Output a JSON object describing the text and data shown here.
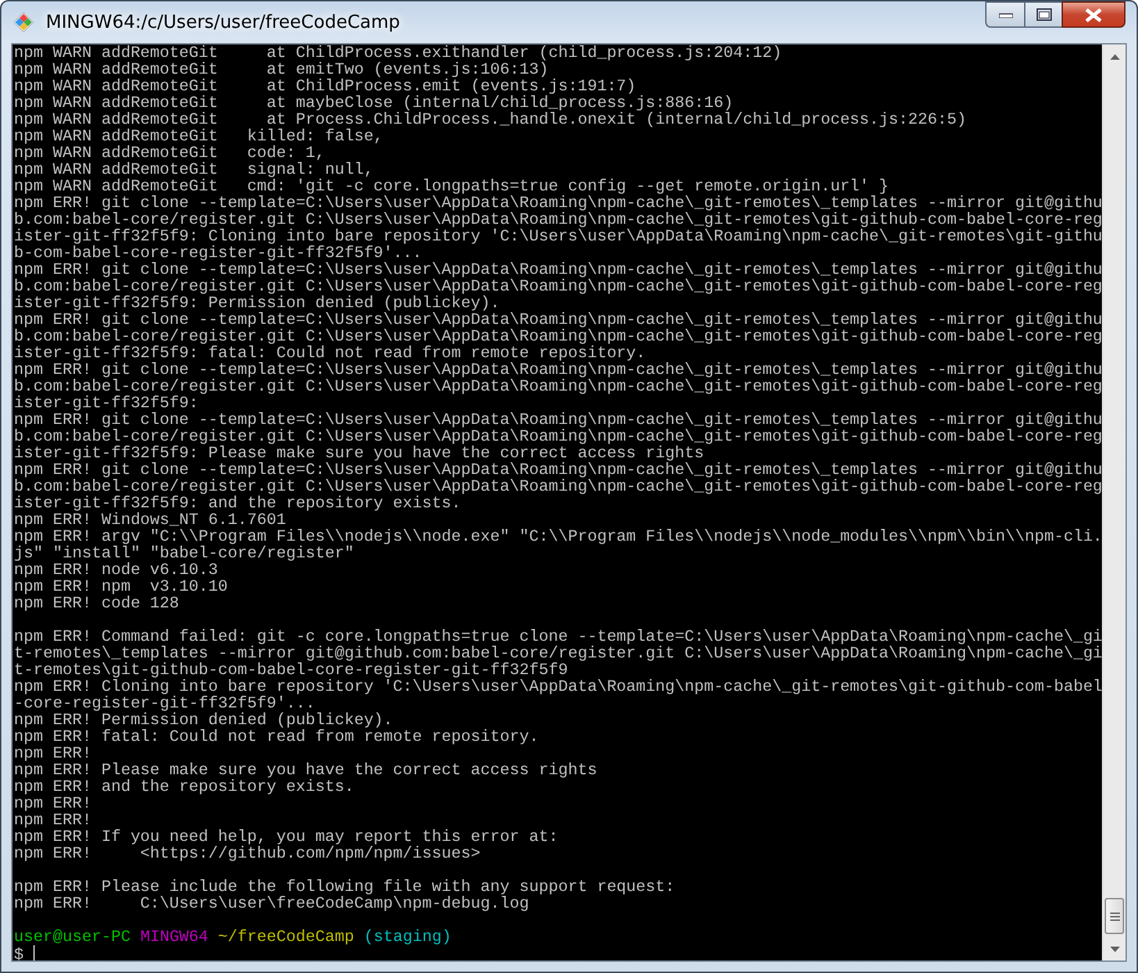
{
  "window": {
    "title": "MINGW64:/c/Users/user/freeCodeCamp"
  },
  "terminal": {
    "lines": [
      {
        "kind": "output",
        "text": "npm WARN addRemoteGit     at ChildProcess.exithandler (child_process.js:204:12)"
      },
      {
        "kind": "output",
        "text": "npm WARN addRemoteGit     at emitTwo (events.js:106:13)"
      },
      {
        "kind": "output",
        "text": "npm WARN addRemoteGit     at ChildProcess.emit (events.js:191:7)"
      },
      {
        "kind": "output",
        "text": "npm WARN addRemoteGit     at maybeClose (internal/child_process.js:886:16)"
      },
      {
        "kind": "output",
        "text": "npm WARN addRemoteGit     at Process.ChildProcess._handle.onexit (internal/child_process.js:226:5)"
      },
      {
        "kind": "output",
        "text": "npm WARN addRemoteGit   killed: false,"
      },
      {
        "kind": "output",
        "text": "npm WARN addRemoteGit   code: 1,"
      },
      {
        "kind": "output",
        "text": "npm WARN addRemoteGit   signal: null,"
      },
      {
        "kind": "output",
        "text": "npm WARN addRemoteGit   cmd: 'git -c core.longpaths=true config --get remote.origin.url' }"
      },
      {
        "kind": "output",
        "text": "npm ERR! git clone --template=C:\\Users\\user\\AppData\\Roaming\\npm-cache\\_git-remotes\\_templates --mirror git@githu"
      },
      {
        "kind": "output",
        "text": "b.com:babel-core/register.git C:\\Users\\user\\AppData\\Roaming\\npm-cache\\_git-remotes\\git-github-com-babel-core-reg"
      },
      {
        "kind": "output",
        "text": "ister-git-ff32f5f9: Cloning into bare repository 'C:\\Users\\user\\AppData\\Roaming\\npm-cache\\_git-remotes\\git-githu"
      },
      {
        "kind": "output",
        "text": "b-com-babel-core-register-git-ff32f5f9'..."
      },
      {
        "kind": "output",
        "text": "npm ERR! git clone --template=C:\\Users\\user\\AppData\\Roaming\\npm-cache\\_git-remotes\\_templates --mirror git@githu"
      },
      {
        "kind": "output",
        "text": "b.com:babel-core/register.git C:\\Users\\user\\AppData\\Roaming\\npm-cache\\_git-remotes\\git-github-com-babel-core-reg"
      },
      {
        "kind": "output",
        "text": "ister-git-ff32f5f9: Permission denied (publickey)."
      },
      {
        "kind": "output",
        "text": "npm ERR! git clone --template=C:\\Users\\user\\AppData\\Roaming\\npm-cache\\_git-remotes\\_templates --mirror git@githu"
      },
      {
        "kind": "output",
        "text": "b.com:babel-core/register.git C:\\Users\\user\\AppData\\Roaming\\npm-cache\\_git-remotes\\git-github-com-babel-core-reg"
      },
      {
        "kind": "output",
        "text": "ister-git-ff32f5f9: fatal: Could not read from remote repository."
      },
      {
        "kind": "output",
        "text": "npm ERR! git clone --template=C:\\Users\\user\\AppData\\Roaming\\npm-cache\\_git-remotes\\_templates --mirror git@githu"
      },
      {
        "kind": "output",
        "text": "b.com:babel-core/register.git C:\\Users\\user\\AppData\\Roaming\\npm-cache\\_git-remotes\\git-github-com-babel-core-reg"
      },
      {
        "kind": "output",
        "text": "ister-git-ff32f5f9:"
      },
      {
        "kind": "output",
        "text": "npm ERR! git clone --template=C:\\Users\\user\\AppData\\Roaming\\npm-cache\\_git-remotes\\_templates --mirror git@githu"
      },
      {
        "kind": "output",
        "text": "b.com:babel-core/register.git C:\\Users\\user\\AppData\\Roaming\\npm-cache\\_git-remotes\\git-github-com-babel-core-reg"
      },
      {
        "kind": "output",
        "text": "ister-git-ff32f5f9: Please make sure you have the correct access rights"
      },
      {
        "kind": "output",
        "text": "npm ERR! git clone --template=C:\\Users\\user\\AppData\\Roaming\\npm-cache\\_git-remotes\\_templates --mirror git@githu"
      },
      {
        "kind": "output",
        "text": "b.com:babel-core/register.git C:\\Users\\user\\AppData\\Roaming\\npm-cache\\_git-remotes\\git-github-com-babel-core-reg"
      },
      {
        "kind": "output",
        "text": "ister-git-ff32f5f9: and the repository exists."
      },
      {
        "kind": "output",
        "text": "npm ERR! Windows_NT 6.1.7601"
      },
      {
        "kind": "output",
        "text": "npm ERR! argv \"C:\\\\Program Files\\\\nodejs\\\\node.exe\" \"C:\\\\Program Files\\\\nodejs\\\\node_modules\\\\npm\\\\bin\\\\npm-cli."
      },
      {
        "kind": "output",
        "text": "js\" \"install\" \"babel-core/register\""
      },
      {
        "kind": "output",
        "text": "npm ERR! node v6.10.3"
      },
      {
        "kind": "output",
        "text": "npm ERR! npm  v3.10.10"
      },
      {
        "kind": "output",
        "text": "npm ERR! code 128"
      },
      {
        "kind": "blank"
      },
      {
        "kind": "output",
        "text": "npm ERR! Command failed: git -c core.longpaths=true clone --template=C:\\Users\\user\\AppData\\Roaming\\npm-cache\\_gi"
      },
      {
        "kind": "output",
        "text": "t-remotes\\_templates --mirror git@github.com:babel-core/register.git C:\\Users\\user\\AppData\\Roaming\\npm-cache\\_gi"
      },
      {
        "kind": "output",
        "text": "t-remotes\\git-github-com-babel-core-register-git-ff32f5f9"
      },
      {
        "kind": "output",
        "text": "npm ERR! Cloning into bare repository 'C:\\Users\\user\\AppData\\Roaming\\npm-cache\\_git-remotes\\git-github-com-babel"
      },
      {
        "kind": "output",
        "text": "-core-register-git-ff32f5f9'..."
      },
      {
        "kind": "output",
        "text": "npm ERR! Permission denied (publickey)."
      },
      {
        "kind": "output",
        "text": "npm ERR! fatal: Could not read from remote repository."
      },
      {
        "kind": "output",
        "text": "npm ERR!"
      },
      {
        "kind": "output",
        "text": "npm ERR! Please make sure you have the correct access rights"
      },
      {
        "kind": "output",
        "text": "npm ERR! and the repository exists."
      },
      {
        "kind": "output",
        "text": "npm ERR!"
      },
      {
        "kind": "output",
        "text": "npm ERR!"
      },
      {
        "kind": "output",
        "text": "npm ERR! If you need help, you may report this error at:"
      },
      {
        "kind": "output",
        "text": "npm ERR!     <https://github.com/npm/npm/issues>"
      },
      {
        "kind": "blank"
      },
      {
        "kind": "output",
        "text": "npm ERR! Please include the following file with any support request:"
      },
      {
        "kind": "output",
        "text": "npm ERR!     C:\\Users\\user\\freeCodeCamp\\npm-debug.log"
      },
      {
        "kind": "blank"
      },
      {
        "kind": "prompt",
        "segments": [
          {
            "text": "user@user-PC",
            "color": "#00c000"
          },
          {
            "text": "MINGW64",
            "color": "#c000c0"
          },
          {
            "text": "~/freeCodeCamp",
            "color": "#bfbf00"
          },
          {
            "text": "(staging)",
            "color": "#00bfbf"
          }
        ]
      },
      {
        "kind": "input",
        "text": "$"
      }
    ]
  }
}
